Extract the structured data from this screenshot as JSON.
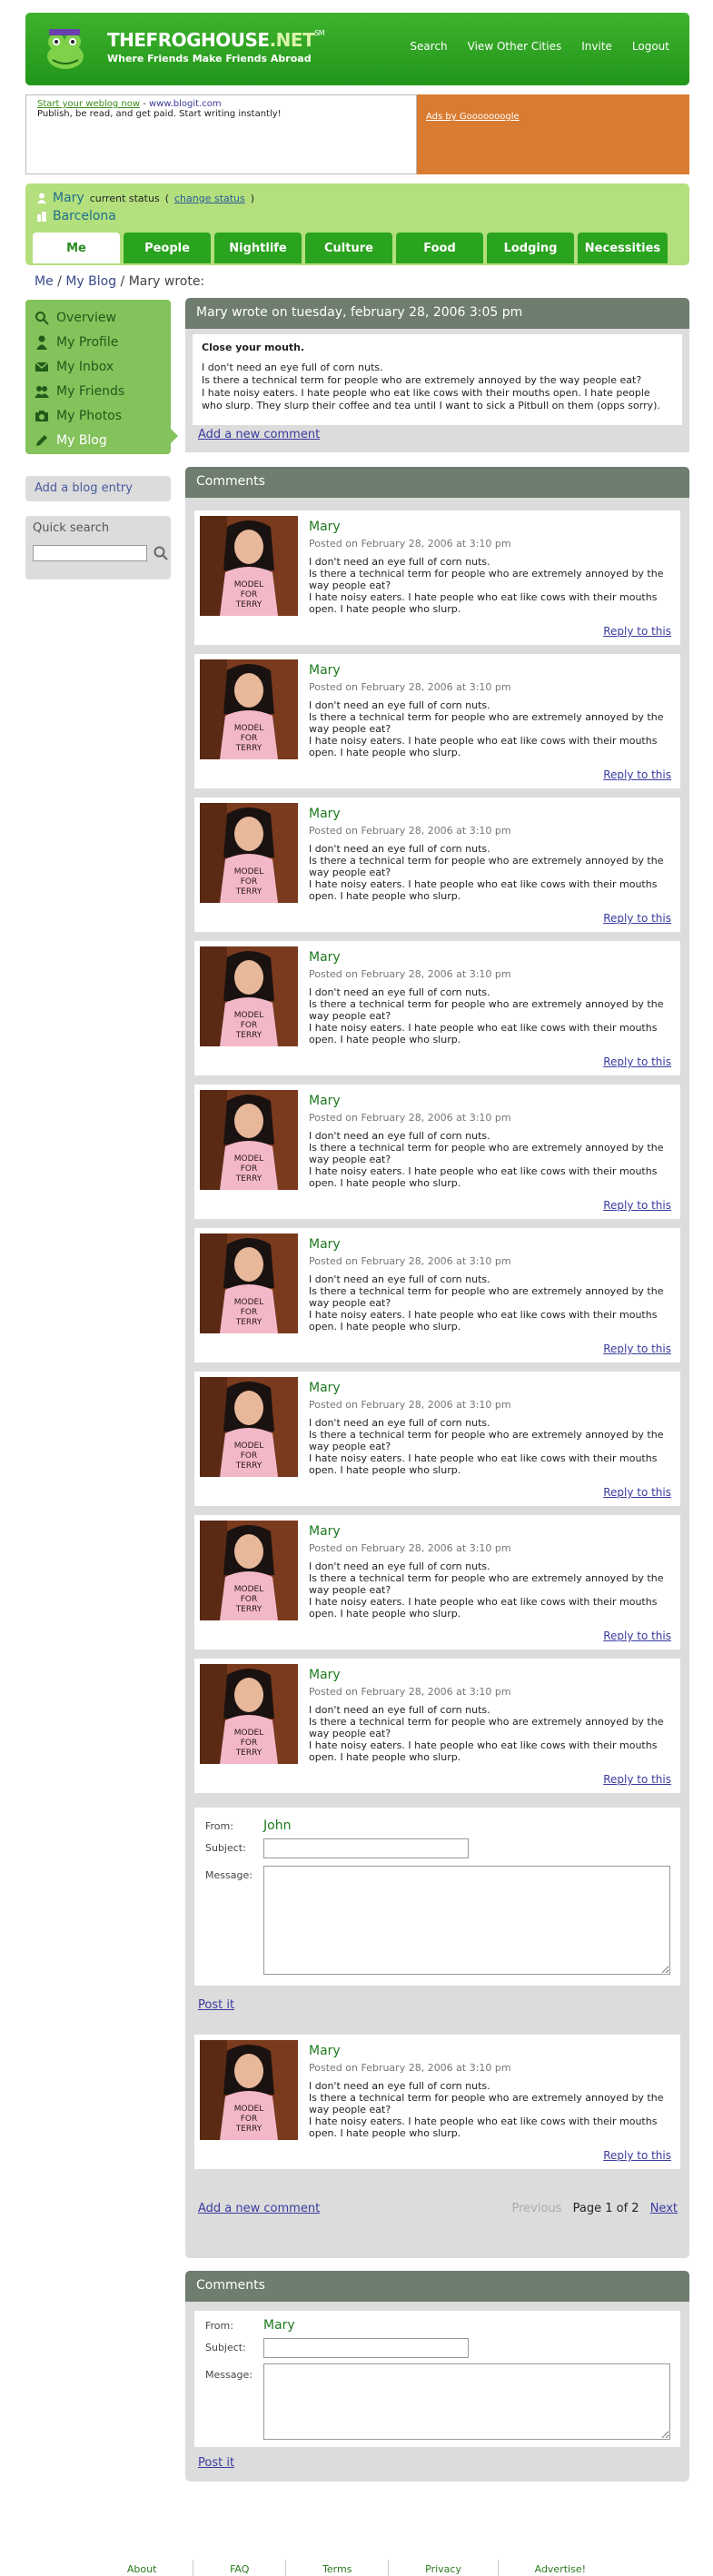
{
  "header": {
    "brand": "THEFROGHOUSE",
    "brand_suffix": ".NET",
    "brand_mark": "SM",
    "tagline": "Where Friends Make Friends Abroad",
    "nav": [
      "Search",
      "View Other Cities",
      "Invite",
      "Logout"
    ]
  },
  "ad": {
    "link_text": "Start your weblog now",
    "separator": " - ",
    "url": "www.blogit.com",
    "body": "Publish, be read, and get paid. Start writing instantly!",
    "google": "Ads by Gooooooogle"
  },
  "user": {
    "name": "Mary",
    "status_label": "current status",
    "change_open": "(",
    "change_link": "change status",
    "change_close": ")",
    "city": "Barcelona"
  },
  "tabs": [
    "Me",
    "People",
    "Nightlife",
    "Culture",
    "Food",
    "Lodging",
    "Necessities"
  ],
  "breadcrumb": {
    "me": "Me",
    "sep": " / ",
    "blog": "My Blog",
    "current": "Mary wrote:"
  },
  "sidebar": {
    "items": [
      "Overview",
      "My Profile",
      "My Inbox",
      "My Friends",
      "My Photos",
      "My Blog"
    ],
    "add_blog": "Add a blog entry",
    "search_title": "Quick search",
    "search_value": ""
  },
  "post": {
    "heading": "Mary wrote on tuesday, february 28, 2006 3:05 pm",
    "title": "Close your mouth.",
    "lines": [
      "I don't need an eye full of corn nuts.",
      "Is there a technical term for people who are extremely annoyed by the way people eat?",
      "I hate noisy eaters. I hate people who eat like cows with their mouths open. I hate people who slurp. They slurp their coffee and tea until I want to sick a Pitbull on them (opps sorry)."
    ],
    "add_comment": "Add a new comment"
  },
  "comments": {
    "heading": "Comments",
    "reply_label": "Reply to this",
    "items": [
      {
        "name": "Mary",
        "date": "Posted on February 28, 2006 at 3:10 pm",
        "line1": "I don't need an eye full of corn nuts.",
        "line2": "Is there a technical term for people who are extremely annoyed by the way people eat?",
        "line3": "I hate noisy eaters. I hate people who eat like cows with their mouths open. I hate people who slurp."
      },
      {
        "name": "Mary",
        "date": "Posted on February 28, 2006 at 3:10 pm",
        "line1": "I don't need an eye full of corn nuts.",
        "line2": "Is there a technical term for people who are extremely annoyed by the way people eat?",
        "line3": "I hate noisy eaters. I hate people who eat like cows with their mouths open. I hate people who slurp."
      },
      {
        "name": "Mary",
        "date": "Posted on February 28, 2006 at 3:10 pm",
        "line1": "I don't need an eye full of corn nuts.",
        "line2": "Is there a technical term for people who are extremely annoyed by the way people eat?",
        "line3": "I hate noisy eaters. I hate people who eat like cows with their mouths open. I hate people who slurp."
      },
      {
        "name": "Mary",
        "date": "Posted on February 28, 2006 at 3:10 pm",
        "line1": "I don't need an eye full of corn nuts.",
        "line2": "Is there a technical term for people who are extremely annoyed by the way people eat?",
        "line3": "I hate noisy eaters. I hate people who eat like cows with their mouths open. I hate people who slurp."
      },
      {
        "name": "Mary",
        "date": "Posted on February 28, 2006 at 3:10 pm",
        "line1": "I don't need an eye full of corn nuts.",
        "line2": "Is there a technical term for people who are extremely annoyed by the way people eat?",
        "line3": "I hate noisy eaters. I hate people who eat like cows with their mouths open. I hate people who slurp."
      },
      {
        "name": "Mary",
        "date": "Posted on February 28, 2006 at 3:10 pm",
        "line1": "I don't need an eye full of corn nuts.",
        "line2": "Is there a technical term for people who are extremely annoyed by the way people eat?",
        "line3": "I hate noisy eaters. I hate people who eat like cows with their mouths open. I hate people who slurp."
      },
      {
        "name": "Mary",
        "date": "Posted on February 28, 2006 at 3:10 pm",
        "line1": "I don't need an eye full of corn nuts.",
        "line2": "Is there a technical term for people who are extremely annoyed by the way people eat?",
        "line3": "I hate noisy eaters. I hate people who eat like cows with their mouths open. I hate people who slurp."
      },
      {
        "name": "Mary",
        "date": "Posted on February 28, 2006 at 3:10 pm",
        "line1": "I don't need an eye full of corn nuts.",
        "line2": "Is there a technical term for people who are extremely annoyed by the way people eat?",
        "line3": "I hate noisy eaters. I hate people who eat like cows with their mouths open. I hate people who slurp."
      },
      {
        "name": "Mary",
        "date": "Posted on February 28, 2006 at 3:10 pm",
        "line1": "I don't need an eye full of corn nuts.",
        "line2": "Is there a technical term for people who are extremely annoyed by the way people eat?",
        "line3": "I hate noisy eaters. I hate people who eat like cows with their mouths open. I hate people who slurp."
      }
    ],
    "after_form": {
      "name": "Mary",
      "date": "Posted on February 28, 2006 at 3:10 pm",
      "line1": "I don't need an eye full of corn nuts.",
      "line2": "Is there a technical term for people who are extremely annoyed by the way people eat?",
      "line3": "I hate noisy eaters. I hate people who eat like cows with their mouths open. I hate people who slurp."
    },
    "form": {
      "from_label": "From:",
      "from_value": "John",
      "subject_label": "Subject:",
      "subject_value": "",
      "message_label": "Message:",
      "message_value": "",
      "submit": "Post it"
    },
    "pager": {
      "add_comment": "Add a new comment",
      "previous": "Previous",
      "page": "Page 1 of 2",
      "next": "Next"
    }
  },
  "comments2": {
    "heading": "Comments",
    "from_label": "From:",
    "from_value": "Mary",
    "subject_label": "Subject:",
    "subject_value": "",
    "message_label": "Message:",
    "message_value": "",
    "submit": "Post it"
  },
  "footer": [
    "About",
    "FAQ",
    "Terms",
    "Privacy",
    "Advertise!"
  ],
  "colors": {
    "brand_green": "#2aa31f",
    "light_green": "#b3df7d",
    "sidebar_green": "#84c25b",
    "panel_header": "#6e7d6e",
    "panel_bg": "#dcdcdc",
    "link_blue": "#3a3aa0",
    "ad_orange": "#d97b30"
  }
}
